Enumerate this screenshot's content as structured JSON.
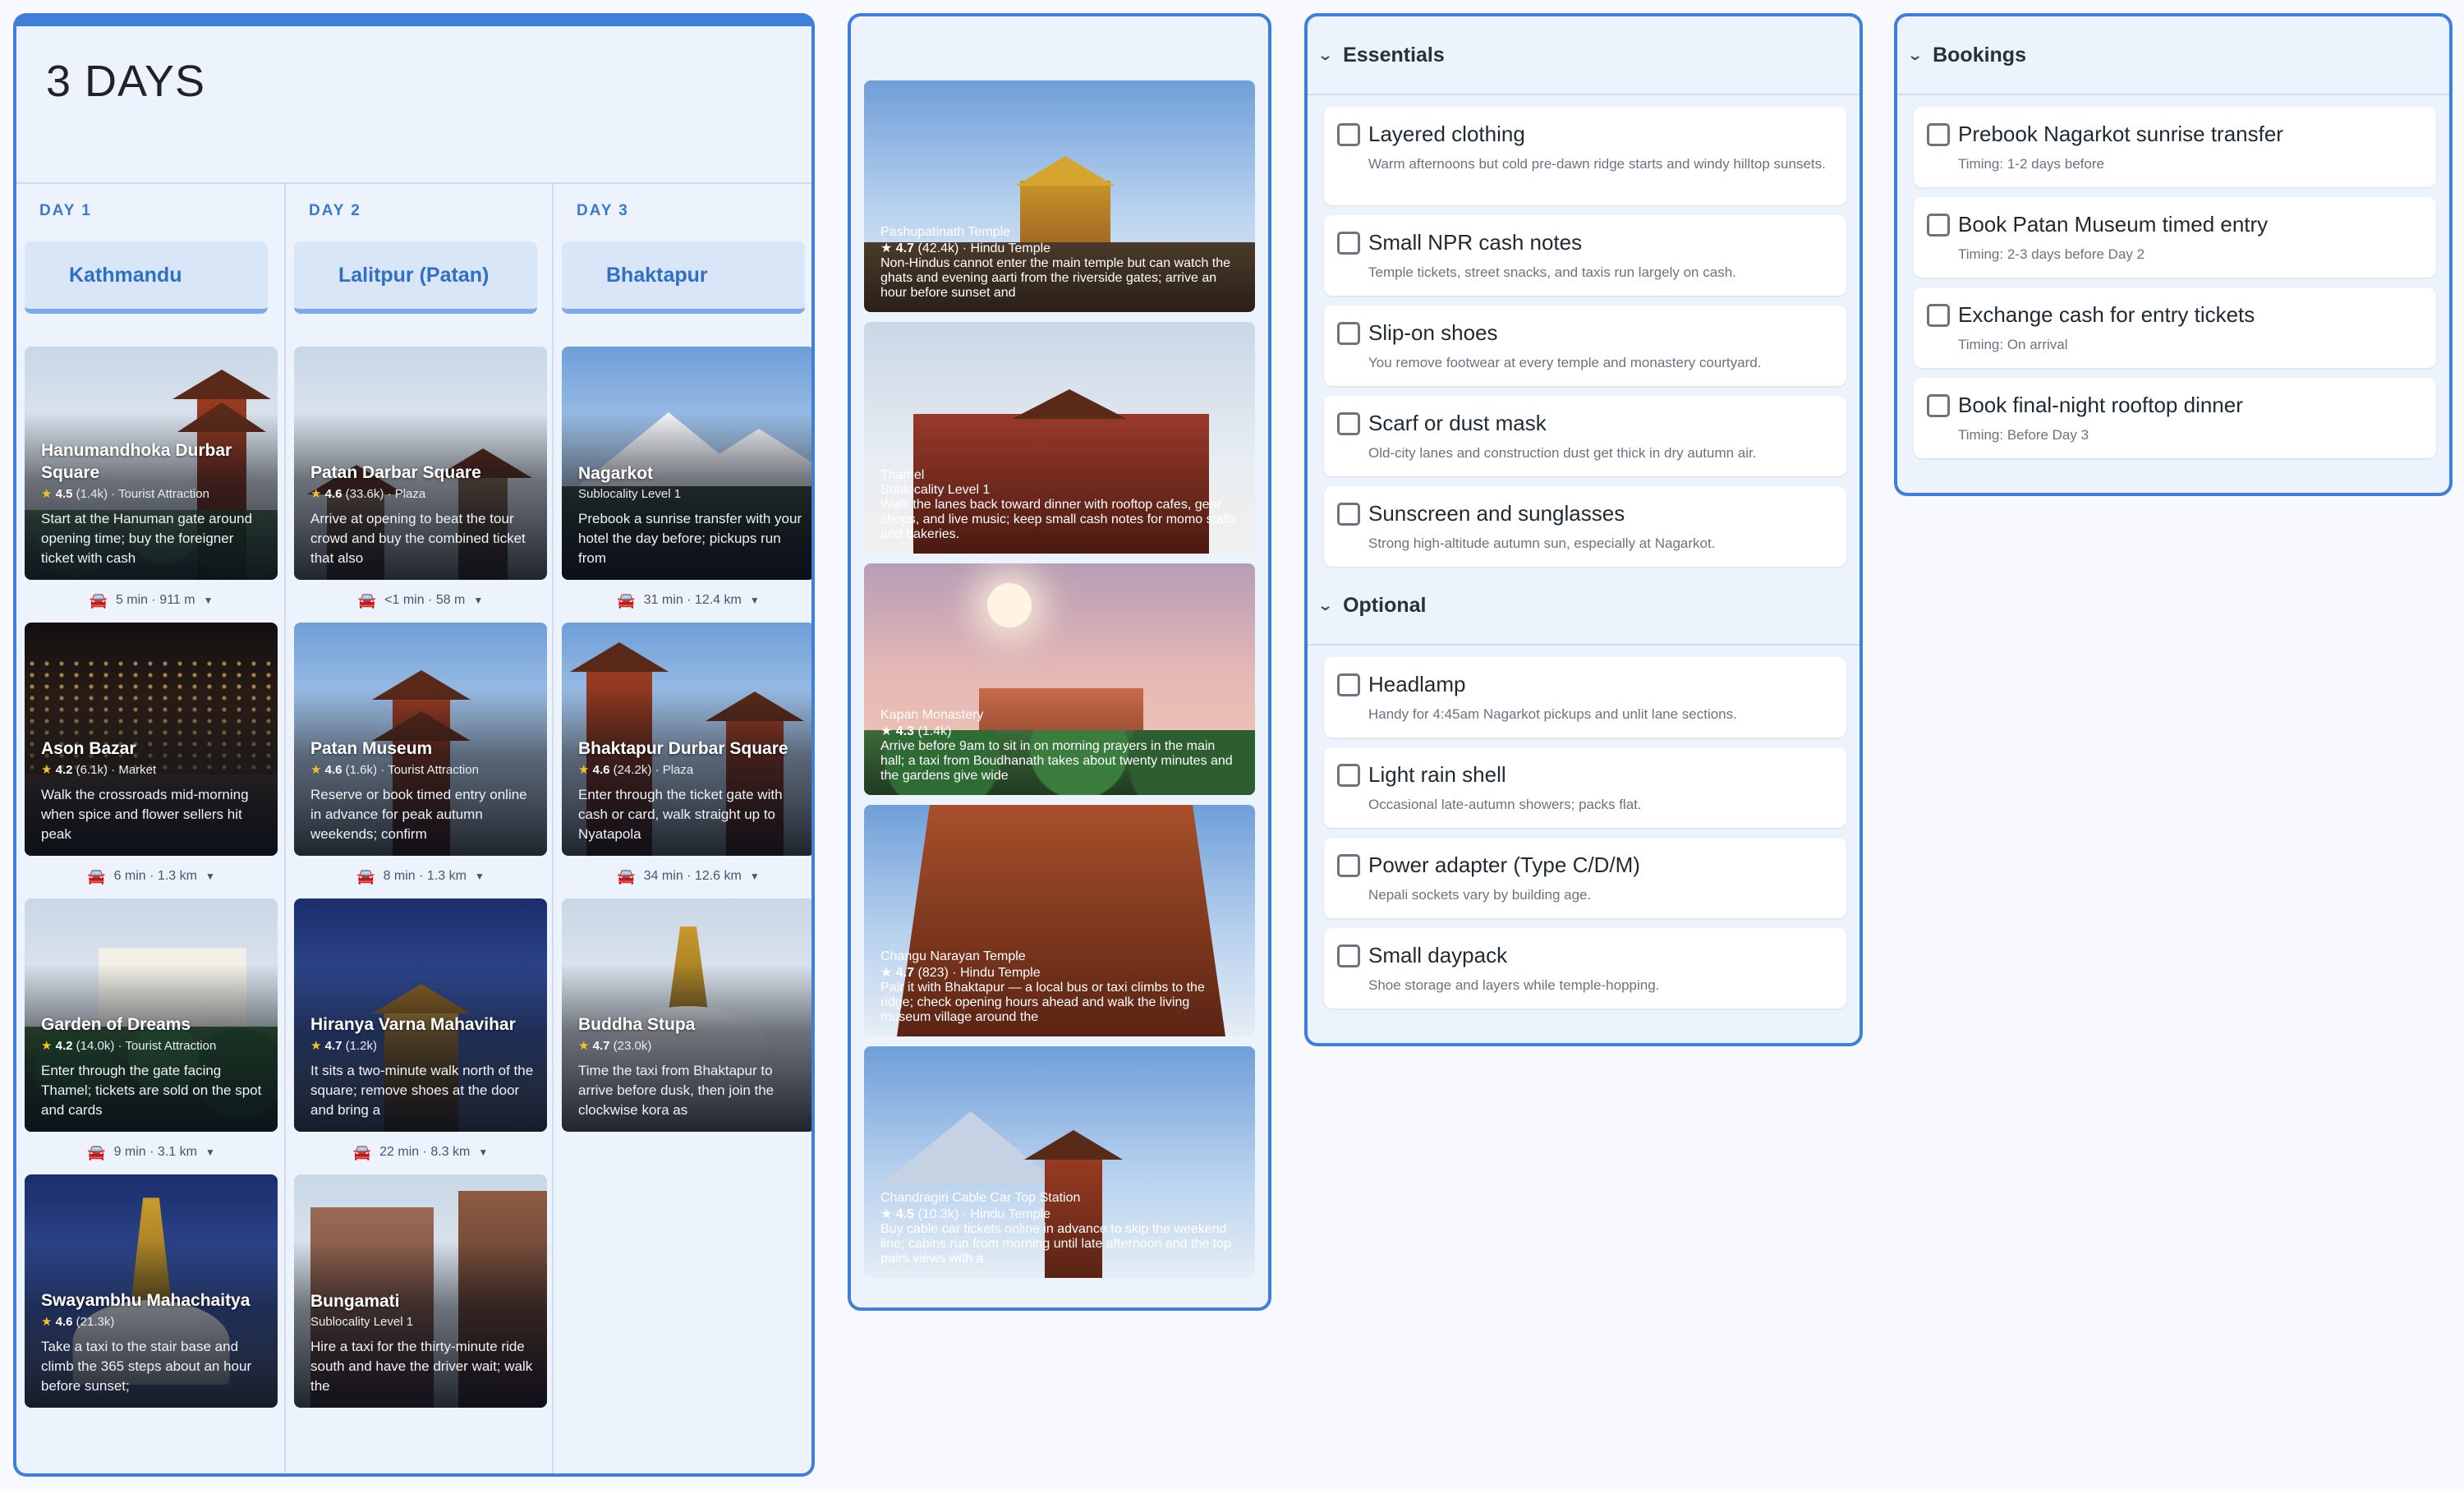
{
  "itinerary": {
    "title": "3 DAYS",
    "days": [
      {
        "label": "DAY 1",
        "city": "Kathmandu",
        "places": [
          {
            "name": "Hanumandhoka Durbar Square",
            "rating": "4.5",
            "reviews": "(1.4k)",
            "category": "Tourist Attraction",
            "desc": "Start at the Hanuman gate around opening time; buy the foreigner ticket with cash"
          },
          {
            "name": "Ason Bazar",
            "rating": "4.2",
            "reviews": "(6.1k)",
            "category": "Market",
            "desc": "Walk the crossroads mid-morning when spice and flower sellers hit peak"
          },
          {
            "name": "Garden of Dreams",
            "rating": "4.2",
            "reviews": "(14.0k)",
            "category": "Tourist Attraction",
            "desc": "Enter through the gate facing Thamel; tickets are sold on the spot and cards"
          },
          {
            "name": "Swayambhu Mahachaitya",
            "rating": "4.6",
            "reviews": "(21.3k)",
            "category": "",
            "desc": "Take a taxi to the stair base and climb the 365 steps about an hour before sunset;"
          }
        ],
        "travel": [
          "5 min · 911 m",
          "6 min · 1.3 km",
          "9 min · 3.1 km"
        ]
      },
      {
        "label": "DAY 2",
        "city": "Lalitpur (Patan)",
        "places": [
          {
            "name": "Patan Darbar Square",
            "rating": "4.6",
            "reviews": "(33.6k)",
            "category": "Plaza",
            "desc": "Arrive at opening to beat the tour crowd and buy the combined ticket that also"
          },
          {
            "name": "Patan Museum",
            "rating": "4.6",
            "reviews": "(1.6k)",
            "category": "Tourist Attraction",
            "desc": "Reserve or book timed entry online in advance for peak autumn weekends; confirm"
          },
          {
            "name": "Hiranya Varna Mahavihar",
            "rating": "4.7",
            "reviews": "(1.2k)",
            "category": "",
            "desc": "It sits a two-minute walk north of the square; remove shoes at the door and bring a"
          },
          {
            "name": "Bungamati",
            "rating": "",
            "reviews": "",
            "category": "Sublocality Level 1",
            "desc": "Hire a taxi for the thirty-minute ride south and have the driver wait; walk the"
          }
        ],
        "travel": [
          "<1 min · 58 m",
          "8 min · 1.3 km",
          "22 min · 8.3 km"
        ]
      },
      {
        "label": "DAY 3",
        "city": "Bhaktapur",
        "places": [
          {
            "name": "Nagarkot",
            "rating": "",
            "reviews": "",
            "category": "Sublocality Level 1",
            "desc": "Prebook a sunrise transfer with your hotel the day before; pickups run from"
          },
          {
            "name": "Bhaktapur Durbar Square",
            "rating": "4.6",
            "reviews": "(24.2k)",
            "category": "Plaza",
            "desc": "Enter through the ticket gate with cash or card, walk straight up to Nyatapola"
          },
          {
            "name": "Buddha Stupa",
            "rating": "4.7",
            "reviews": "(23.0k)",
            "category": "",
            "desc": "Time the taxi from Bhaktapur to arrive before dusk, then join the clockwise kora as"
          }
        ],
        "travel": [
          "31 min · 12.4 km",
          "34 min · 12.6 km"
        ]
      }
    ]
  },
  "ideas": [
    {
      "name": "Pashupatinath Temple",
      "rating": "4.7",
      "reviews": "(42.4k)",
      "category": "Hindu Temple",
      "desc": "Non-Hindus cannot enter the main temple but can watch the ghats and evening aarti from the riverside gates; arrive an hour before sunset and"
    },
    {
      "name": "Thamel",
      "rating": "",
      "reviews": "",
      "category": "Sublocality Level 1",
      "desc": "Walk the lanes back toward dinner with rooftop cafes, gear shops, and live music; keep small cash notes for momo stalls and bakeries."
    },
    {
      "name": "Kapan Monastery",
      "rating": "4.3",
      "reviews": "(1.4k)",
      "category": "",
      "desc": "Arrive before 9am to sit in on morning prayers in the main hall; a taxi from Boudhanath takes about twenty minutes and the gardens give wide"
    },
    {
      "name": "Changu Narayan Temple",
      "rating": "4.7",
      "reviews": "(823)",
      "category": "Hindu Temple",
      "desc": "Pair it with Bhaktapur — a local bus or taxi climbs to the ridge; check opening hours ahead and walk the living museum village around the"
    },
    {
      "name": "Chandragiri Cable Car Top Station",
      "rating": "4.5",
      "reviews": "(10.3k)",
      "category": "Hindu Temple",
      "desc": "Buy cable car tickets online in advance to skip the weekend line; cabins run from morning until late afternoon and the top pairs views with a"
    }
  ],
  "packing": {
    "essentials_title": "Essentials",
    "essentials": [
      {
        "label": "Layered clothing",
        "note": "Warm afternoons but cold pre-dawn ridge starts and windy hilltop sunsets."
      },
      {
        "label": "Small NPR cash notes",
        "note": "Temple tickets, street snacks, and taxis run largely on cash."
      },
      {
        "label": "Slip-on shoes",
        "note": "You remove footwear at every temple and monastery courtyard."
      },
      {
        "label": "Scarf or dust mask",
        "note": "Old-city lanes and construction dust get thick in dry autumn air."
      },
      {
        "label": "Sunscreen and sunglasses",
        "note": "Strong high-altitude autumn sun, especially at Nagarkot."
      }
    ],
    "optional_title": "Optional",
    "optional": [
      {
        "label": "Headlamp",
        "note": "Handy for 4:45am Nagarkot pickups and unlit lane sections."
      },
      {
        "label": "Light rain shell",
        "note": "Occasional late-autumn showers; packs flat."
      },
      {
        "label": "Power adapter (Type C/D/M)",
        "note": "Nepali sockets vary by building age."
      },
      {
        "label": "Small daypack",
        "note": "Shoe storage and layers while temple-hopping."
      }
    ]
  },
  "bookings": {
    "title": "Bookings",
    "items": [
      {
        "label": "Prebook Nagarkot sunrise transfer",
        "note": "Timing: 1-2 days before"
      },
      {
        "label": "Book Patan Museum timed entry",
        "note": "Timing: 2-3 days before Day 2"
      },
      {
        "label": "Exchange cash for entry tickets",
        "note": "Timing: On arrival"
      },
      {
        "label": "Book final-night rooftop dinner",
        "note": "Timing: Before Day 3"
      }
    ]
  },
  "icons": {
    "car": "car-icon",
    "caret": "caret-down-icon",
    "star": "star-icon",
    "chevron": "chevron-down-icon",
    "checkbox": "checkbox-icon"
  },
  "colors": {
    "accent": "#3f7fdb",
    "panel": "#edf3fd",
    "star": "#f7c02b"
  }
}
